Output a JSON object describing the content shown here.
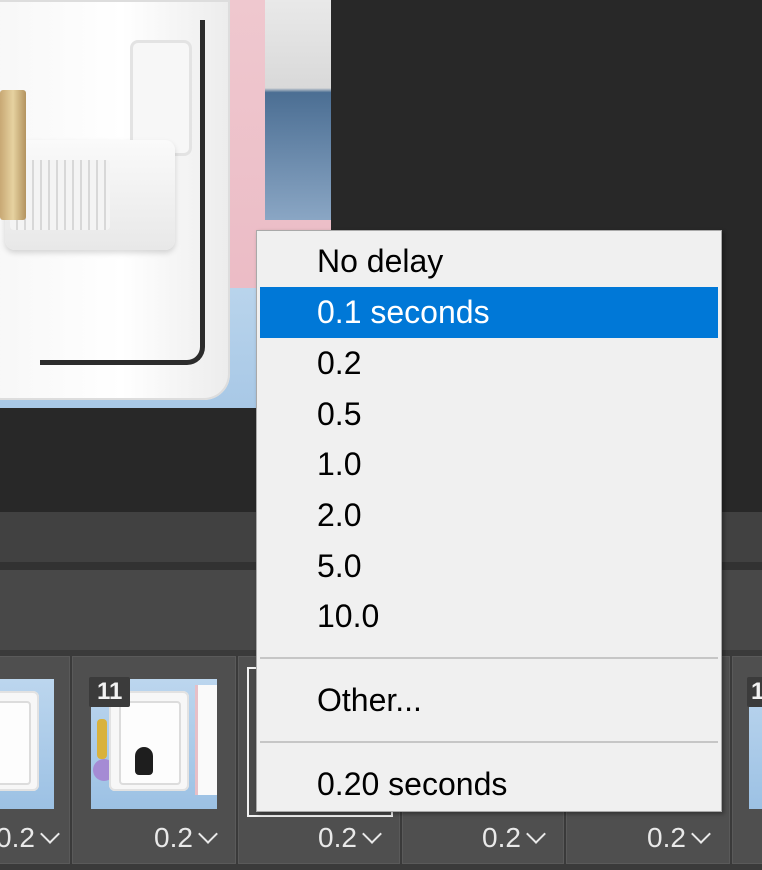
{
  "delay_menu": {
    "items": [
      {
        "label": "No delay",
        "selected": false
      },
      {
        "label": "0.1 seconds",
        "selected": true
      },
      {
        "label": "0.2",
        "selected": false
      },
      {
        "label": "0.5",
        "selected": false
      },
      {
        "label": "1.0",
        "selected": false
      },
      {
        "label": "2.0",
        "selected": false
      },
      {
        "label": "5.0",
        "selected": false
      },
      {
        "label": "10.0",
        "selected": false
      }
    ],
    "other_label": "Other...",
    "current_label": "0.20 seconds",
    "highlight_color": "#0078d7"
  },
  "timeline": {
    "frames": [
      {
        "number": "",
        "delay": "0.2"
      },
      {
        "number": "11",
        "delay": "0.2"
      },
      {
        "number": "",
        "delay": "0.2"
      },
      {
        "number": "",
        "delay": "0.2"
      },
      {
        "number": "",
        "delay": "0.2"
      },
      {
        "number": "1",
        "delay": ""
      }
    ]
  },
  "icons": {
    "delay_dropdown": "chevron-down-icon"
  }
}
